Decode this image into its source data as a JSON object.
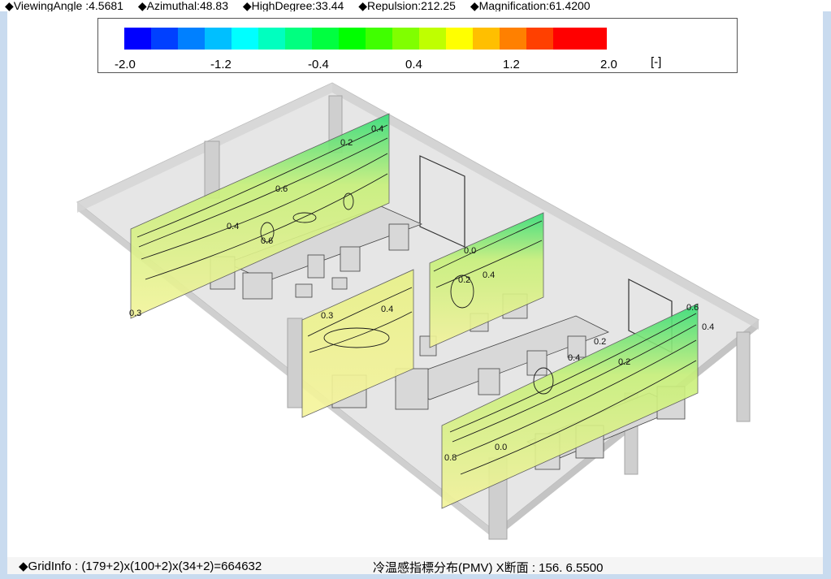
{
  "header": {
    "viewing_angle": "◆ViewingAngle :4.5681",
    "azimuthal": "◆Azimuthal:48.83",
    "high_degree": "◆HighDegree:33.44",
    "repulsion": "◆Repulsion:212.25",
    "magnification": "◆Magnification:61.4200"
  },
  "legend": {
    "ticks": [
      "-2.0",
      "-1.2",
      "-0.4",
      "0.4",
      "1.2",
      "2.0"
    ],
    "unit": "[-]",
    "colors": [
      "#0000ff",
      "#0040ff",
      "#0080ff",
      "#00bfff",
      "#00ffff",
      "#00ffbf",
      "#00ff80",
      "#00ff40",
      "#00ff00",
      "#40ff00",
      "#80ff00",
      "#bfff00",
      "#ffff00",
      "#ffbf00",
      "#ff8000",
      "#ff4000",
      "#ff0000",
      "#ff0000"
    ]
  },
  "contour_labels": [
    "0.4",
    "0.2",
    "0.6",
    "0.4",
    "0.6",
    "0.3",
    "0.4",
    "0.3",
    "0.2",
    "0.0",
    "0.4",
    "0.2",
    "0.4",
    "0.2",
    "0.6",
    "0.8",
    "0.4",
    "0.0"
  ],
  "footer": {
    "grid_info": "◆GridInfo : (179+2)x(100+2)x(34+2)=664632",
    "section_info": "冷温感指標分布(PMV) X断面 : 156. 6.5500"
  }
}
